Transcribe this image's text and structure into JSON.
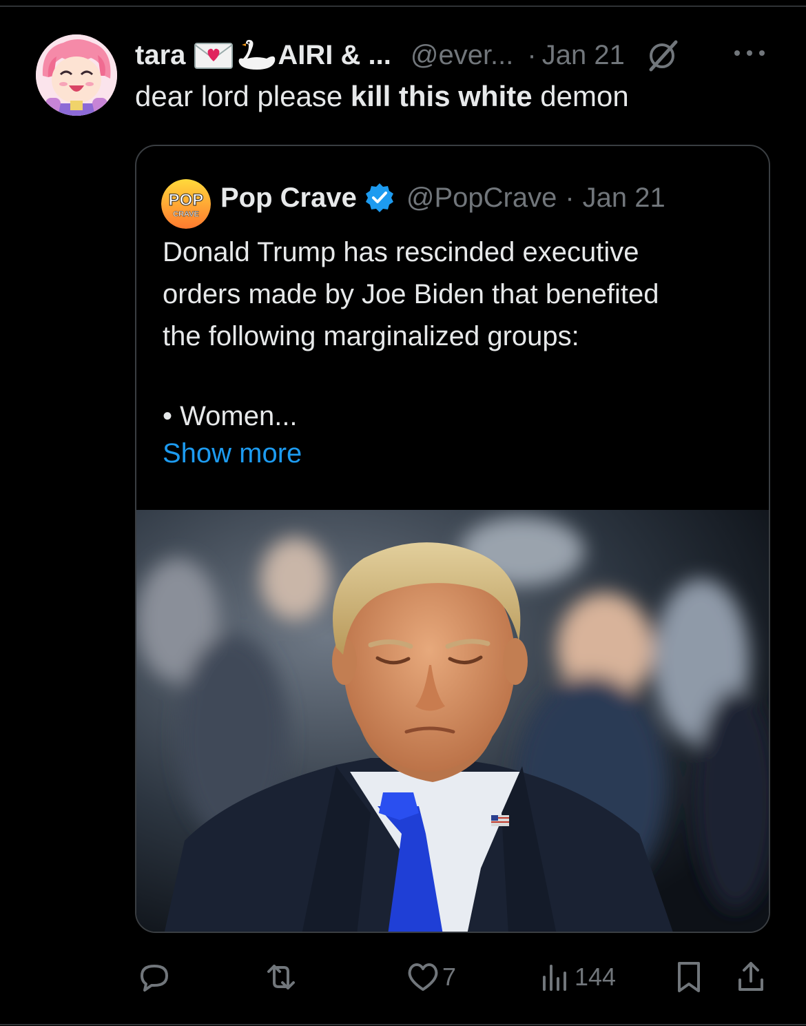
{
  "tweet": {
    "display_name": "tara",
    "emoji_1": "envelope-with-heart-emoji",
    "emoji_2": "swan-emoji",
    "display_name_suffix": "AIRI & ...",
    "handle": "@ever...",
    "separator": "·",
    "date": "Jan 21",
    "text_before": "dear lord please ",
    "text_bold": "kill this white",
    "text_after": " demon"
  },
  "quote": {
    "display_name": "Pop Crave",
    "avatar_text_1": "POP",
    "avatar_text_2": "CRAVE",
    "handle": "@PopCrave",
    "separator": "·",
    "date": "Jan 21",
    "lines": [
      "Donald Trump has rescinded executive",
      "orders made by Joe Biden that benefited",
      "the following marginalized groups:"
    ],
    "bullet": "• Women...",
    "show_more": "Show more"
  },
  "actions": {
    "reply_count": "",
    "retweet_count": "",
    "like_count": "7",
    "views_count": "144"
  },
  "colors": {
    "background": "#000000",
    "text": "#e7e9ea",
    "muted": "#71767b",
    "link": "#1d9bf0",
    "border": "#3a3e42",
    "verified": "#1d9bf0"
  }
}
